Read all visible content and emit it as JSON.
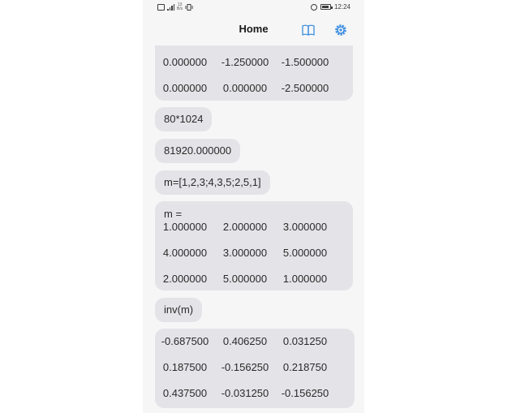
{
  "status_bar": {
    "network_speed_value": "13",
    "network_speed_unit": "B/s",
    "time": "12:24"
  },
  "header": {
    "title": "Home",
    "book_icon": "book-icon",
    "settings_icon": "gear-icon",
    "accent_color": "#3b8ee0"
  },
  "messages": [
    {
      "rows": [
        [
          "0.000000",
          "-1.250000",
          "-1.500000"
        ],
        [
          "0.000000",
          "0.000000",
          "-2.500000"
        ]
      ]
    },
    {
      "text": "80*1024"
    },
    {
      "text": "81920.000000"
    },
    {
      "text": "m=[1,2,3;4,3,5;2,5,1]"
    },
    {
      "label": "m =",
      "rows": [
        [
          "1.000000",
          "2.000000",
          "3.000000"
        ],
        [
          "4.000000",
          "3.000000",
          "5.000000"
        ],
        [
          "2.000000",
          "5.000000",
          "1.000000"
        ]
      ]
    },
    {
      "text": "inv(m)"
    },
    {
      "rows": [
        [
          "-0.687500",
          "0.406250",
          "0.031250"
        ],
        [
          "0.187500",
          "-0.156250",
          "0.218750"
        ],
        [
          "0.437500",
          "-0.031250",
          "-0.156250"
        ]
      ]
    }
  ]
}
